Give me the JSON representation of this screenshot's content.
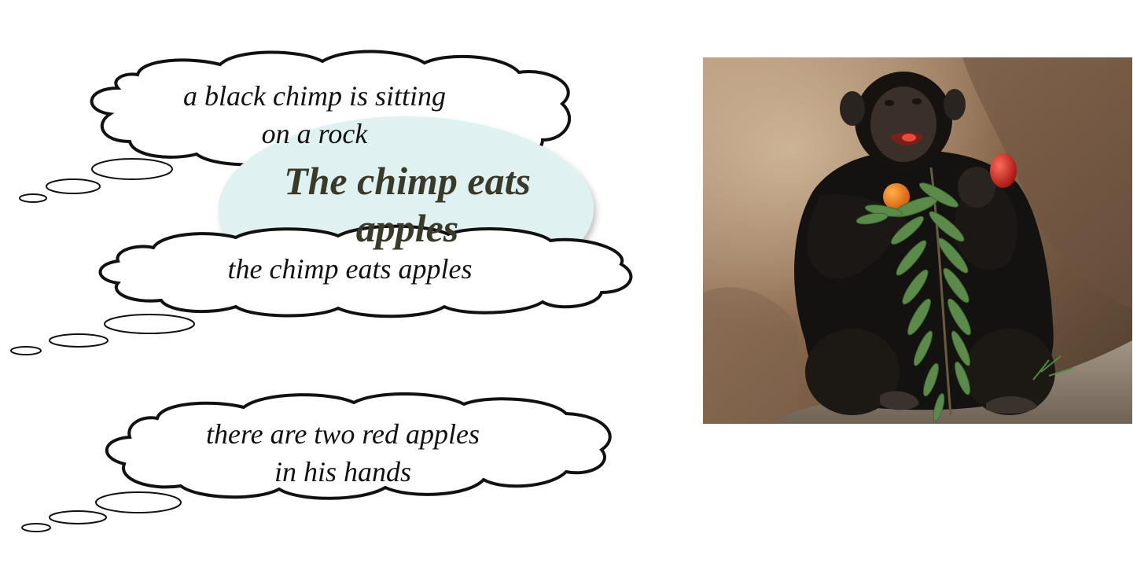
{
  "thought_bubbles": [
    {
      "line1": "a black chimp is sitting",
      "line2": "on a rock"
    },
    {
      "line1": "the chimp eats apples"
    },
    {
      "line1": "there are two red apples",
      "line2": "in his hands"
    }
  ],
  "speech_bubble": {
    "line1": "The chimp eats",
    "line2": "apples",
    "fill_color": "#dff1f0"
  },
  "photo": {
    "icon": "chimpanzee-photo-icon",
    "subject": "chimpanzee holding leaves, an orange and a red apple on a rock"
  },
  "colors": {
    "bubble_stroke": "#111111",
    "bubble_fill": "#ffffff",
    "speech_fill": "#dff1f0",
    "speech_text": "#3a3a2a"
  }
}
